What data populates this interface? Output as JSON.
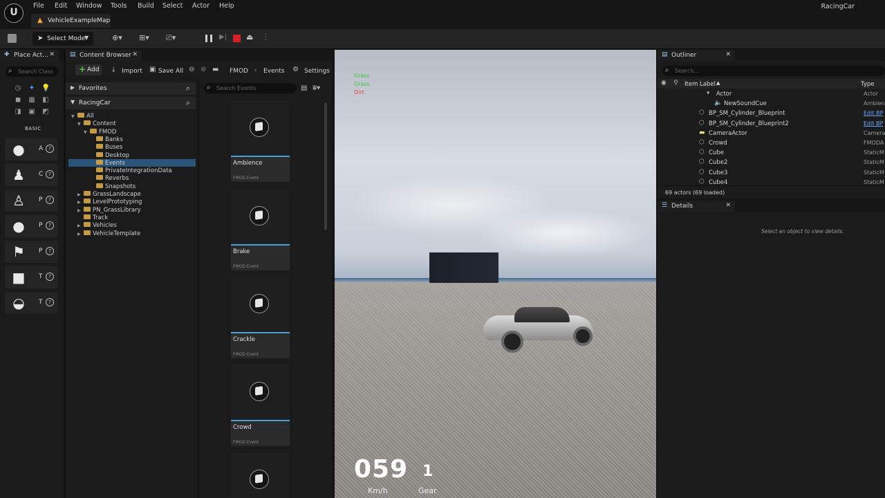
{
  "menu": {
    "items": [
      "File",
      "Edit",
      "Window",
      "Tools",
      "Build",
      "Select",
      "Actor",
      "Help"
    ],
    "project": "RacingCar"
  },
  "map_tab": {
    "label": "VehicleExampleMap"
  },
  "toolbar": {
    "select_mode": "Select Mode"
  },
  "tabs": {
    "place_actors": "Place Act...",
    "content_browser": "Content Browser",
    "outliner": "Outliner",
    "details": "Details"
  },
  "place_actors": {
    "search_placeholder": "Search Class",
    "basic_label": "BASIC",
    "items": [
      {
        "letter": "A",
        "icon": "sphere-icon"
      },
      {
        "letter": "C",
        "icon": "character-icon"
      },
      {
        "letter": "P",
        "icon": "pawn-icon"
      },
      {
        "letter": "P",
        "icon": "point-light-icon"
      },
      {
        "letter": "P",
        "icon": "player-start-icon"
      },
      {
        "letter": "T",
        "icon": "trigger-box-icon"
      },
      {
        "letter": "T",
        "icon": "trigger-sphere-icon"
      }
    ]
  },
  "content_browser": {
    "add_label": "Add",
    "import_label": "Import",
    "save_all_label": "Save All",
    "breadcrumb": [
      "FMOD",
      "Events"
    ],
    "settings_label": "Settings",
    "favorites_label": "Favorites",
    "project_label": "RacingCar",
    "tree": [
      {
        "label": "All",
        "indent": 0,
        "arrow": "▼"
      },
      {
        "label": "Content",
        "indent": 1,
        "arrow": "▼"
      },
      {
        "label": "FMOD",
        "indent": 2,
        "arrow": "▼"
      },
      {
        "label": "Banks",
        "indent": 3,
        "arrow": ""
      },
      {
        "label": "Buses",
        "indent": 3,
        "arrow": ""
      },
      {
        "label": "Desktop",
        "indent": 3,
        "arrow": ""
      },
      {
        "label": "Events",
        "indent": 3,
        "arrow": ""
      },
      {
        "label": "PrivateIntegrationData",
        "indent": 3,
        "arrow": ""
      },
      {
        "label": "Reverbs",
        "indent": 3,
        "arrow": ""
      },
      {
        "label": "Snapshots",
        "indent": 3,
        "arrow": ""
      },
      {
        "label": "GrassLandscape",
        "indent": 1,
        "arrow": "▶"
      },
      {
        "label": "LevelPrototyping",
        "indent": 1,
        "arrow": "▶"
      },
      {
        "label": "PN_GrassLibrary",
        "indent": 1,
        "arrow": "▶"
      },
      {
        "label": "Track",
        "indent": 1,
        "arrow": ""
      },
      {
        "label": "Vehicles",
        "indent": 1,
        "arrow": "▶"
      },
      {
        "label": "VehicleTemplate",
        "indent": 1,
        "arrow": "▶"
      }
    ],
    "events_search_placeholder": "Search Events",
    "assets": [
      {
        "name": "Ambience",
        "type": "FMOD Event"
      },
      {
        "name": "Brake",
        "type": "FMOD Event"
      },
      {
        "name": "Crackle",
        "type": "FMOD Event"
      },
      {
        "name": "Crowd",
        "type": "FMOD Event"
      },
      {
        "name": "",
        "type": ""
      }
    ]
  },
  "viewport": {
    "surfaces": [
      "Grass",
      "Grass",
      "Dirt"
    ],
    "speed": "059",
    "speed_unit": "Km/h",
    "gear": "1",
    "gear_label": "Gear"
  },
  "outliner": {
    "search_placeholder": "Search...",
    "col_label": "Item Label",
    "col_type": "Type",
    "rows": [
      {
        "name": "Actor",
        "type": "Actor",
        "indent": 1,
        "icon": "folder-icon",
        "link": false
      },
      {
        "name": "NewSoundCue",
        "type": "Ambien",
        "indent": 2,
        "icon": "speaker-icon",
        "link": false
      },
      {
        "name": "BP_SM_Cylinder_Blueprint",
        "type": "Edit BP",
        "indent": 0,
        "icon": "actor-icon",
        "link": true
      },
      {
        "name": "BP_SM_Cylinder_Blueprint2",
        "type": "Edit BP",
        "indent": 0,
        "icon": "actor-icon",
        "link": true
      },
      {
        "name": "CameraActor",
        "type": "Camera",
        "indent": 0,
        "icon": "camera-icon",
        "link": false
      },
      {
        "name": "Crowd",
        "type": "FMODA",
        "indent": 0,
        "icon": "actor-icon",
        "link": false
      },
      {
        "name": "Cube",
        "type": "StaticM",
        "indent": 0,
        "icon": "actor-icon",
        "link": false
      },
      {
        "name": "Cube2",
        "type": "StaticM",
        "indent": 0,
        "icon": "actor-icon",
        "link": false
      },
      {
        "name": "Cube3",
        "type": "StaticM",
        "indent": 0,
        "icon": "actor-icon",
        "link": false
      },
      {
        "name": "Cube4",
        "type": "StaticM",
        "indent": 0,
        "icon": "actor-icon",
        "link": false
      }
    ],
    "actor_count": "69 actors (69 loaded)"
  },
  "details": {
    "empty_text": "Select an object to view details."
  },
  "colors": {
    "accent": "#4ba0d8",
    "selection": "#2b5479",
    "stop": "#d3202a",
    "folder": "#c49a45"
  }
}
